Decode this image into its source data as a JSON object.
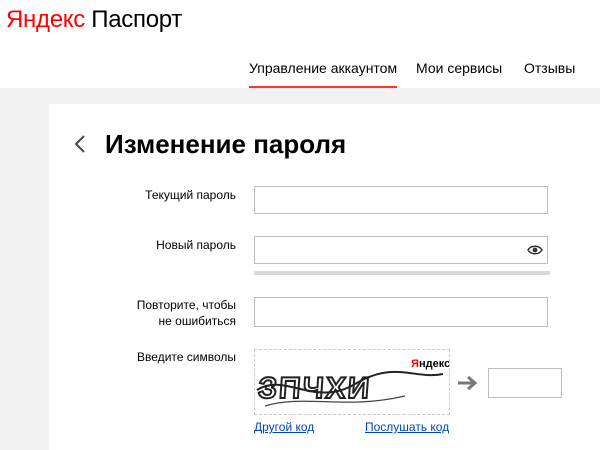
{
  "header": {
    "logo_brand": "Яндекс",
    "logo_product": "Паспорт",
    "nav": [
      {
        "label": "Управление аккаунтом",
        "active": true
      },
      {
        "label": "Мои сервисы",
        "active": false
      },
      {
        "label": "Отзывы",
        "active": false
      }
    ]
  },
  "form": {
    "title": "Изменение пароля",
    "current_password_label": "Текущий пароль",
    "current_password_value": "",
    "new_password_label": "Новый пароль",
    "new_password_value": "",
    "repeat_label_line1": "Повторите, чтобы",
    "repeat_label_line2": "не ошибиться",
    "repeat_password_value": "",
    "captcha_label": "Введите символы",
    "captcha_text": "ЗПЧХИ",
    "captcha_brand": "Яндекс",
    "captcha_value": "",
    "other_code_link": "Другой код",
    "listen_code_link": "Послушать код"
  },
  "icons": {
    "back": "chevron-left-icon",
    "eye": "eye-icon",
    "arrow": "arrow-right-icon"
  },
  "colors": {
    "brand_red": "#ff0000",
    "active_underline": "#ff3333",
    "link": "#0044bb",
    "background": "#f2f2f2"
  }
}
